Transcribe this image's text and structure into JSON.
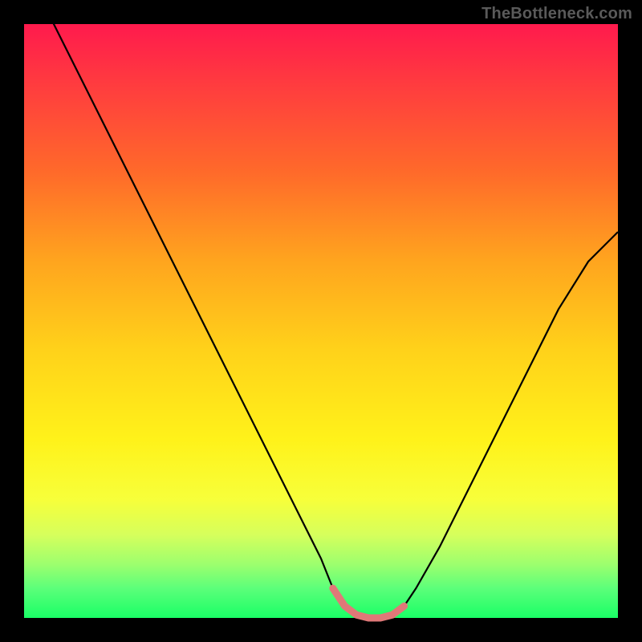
{
  "watermark": "TheBottleneck.com",
  "chart_data": {
    "type": "line",
    "title": "",
    "xlabel": "",
    "ylabel": "",
    "xlim": [
      0,
      100
    ],
    "ylim": [
      0,
      100
    ],
    "series": [
      {
        "name": "bottleneck-curve",
        "x": [
          0,
          5,
          10,
          15,
          20,
          25,
          30,
          35,
          40,
          45,
          50,
          52,
          54,
          56,
          58,
          60,
          62,
          64,
          66,
          70,
          75,
          80,
          85,
          90,
          95,
          100
        ],
        "values": [
          110,
          100,
          90,
          80,
          70,
          60,
          50,
          40,
          30,
          20,
          10,
          5,
          2,
          0.5,
          0,
          0,
          0.5,
          2,
          5,
          12,
          22,
          32,
          42,
          52,
          60,
          65
        ]
      },
      {
        "name": "valley-highlight",
        "x": [
          52,
          54,
          56,
          58,
          60,
          62,
          64
        ],
        "values": [
          5,
          2,
          0.5,
          0,
          0,
          0.5,
          2
        ]
      }
    ],
    "colors": {
      "curve": "#000000",
      "highlight": "#e07878",
      "gradient_top": "#ff1a4d",
      "gradient_bottom": "#1aff66"
    }
  }
}
